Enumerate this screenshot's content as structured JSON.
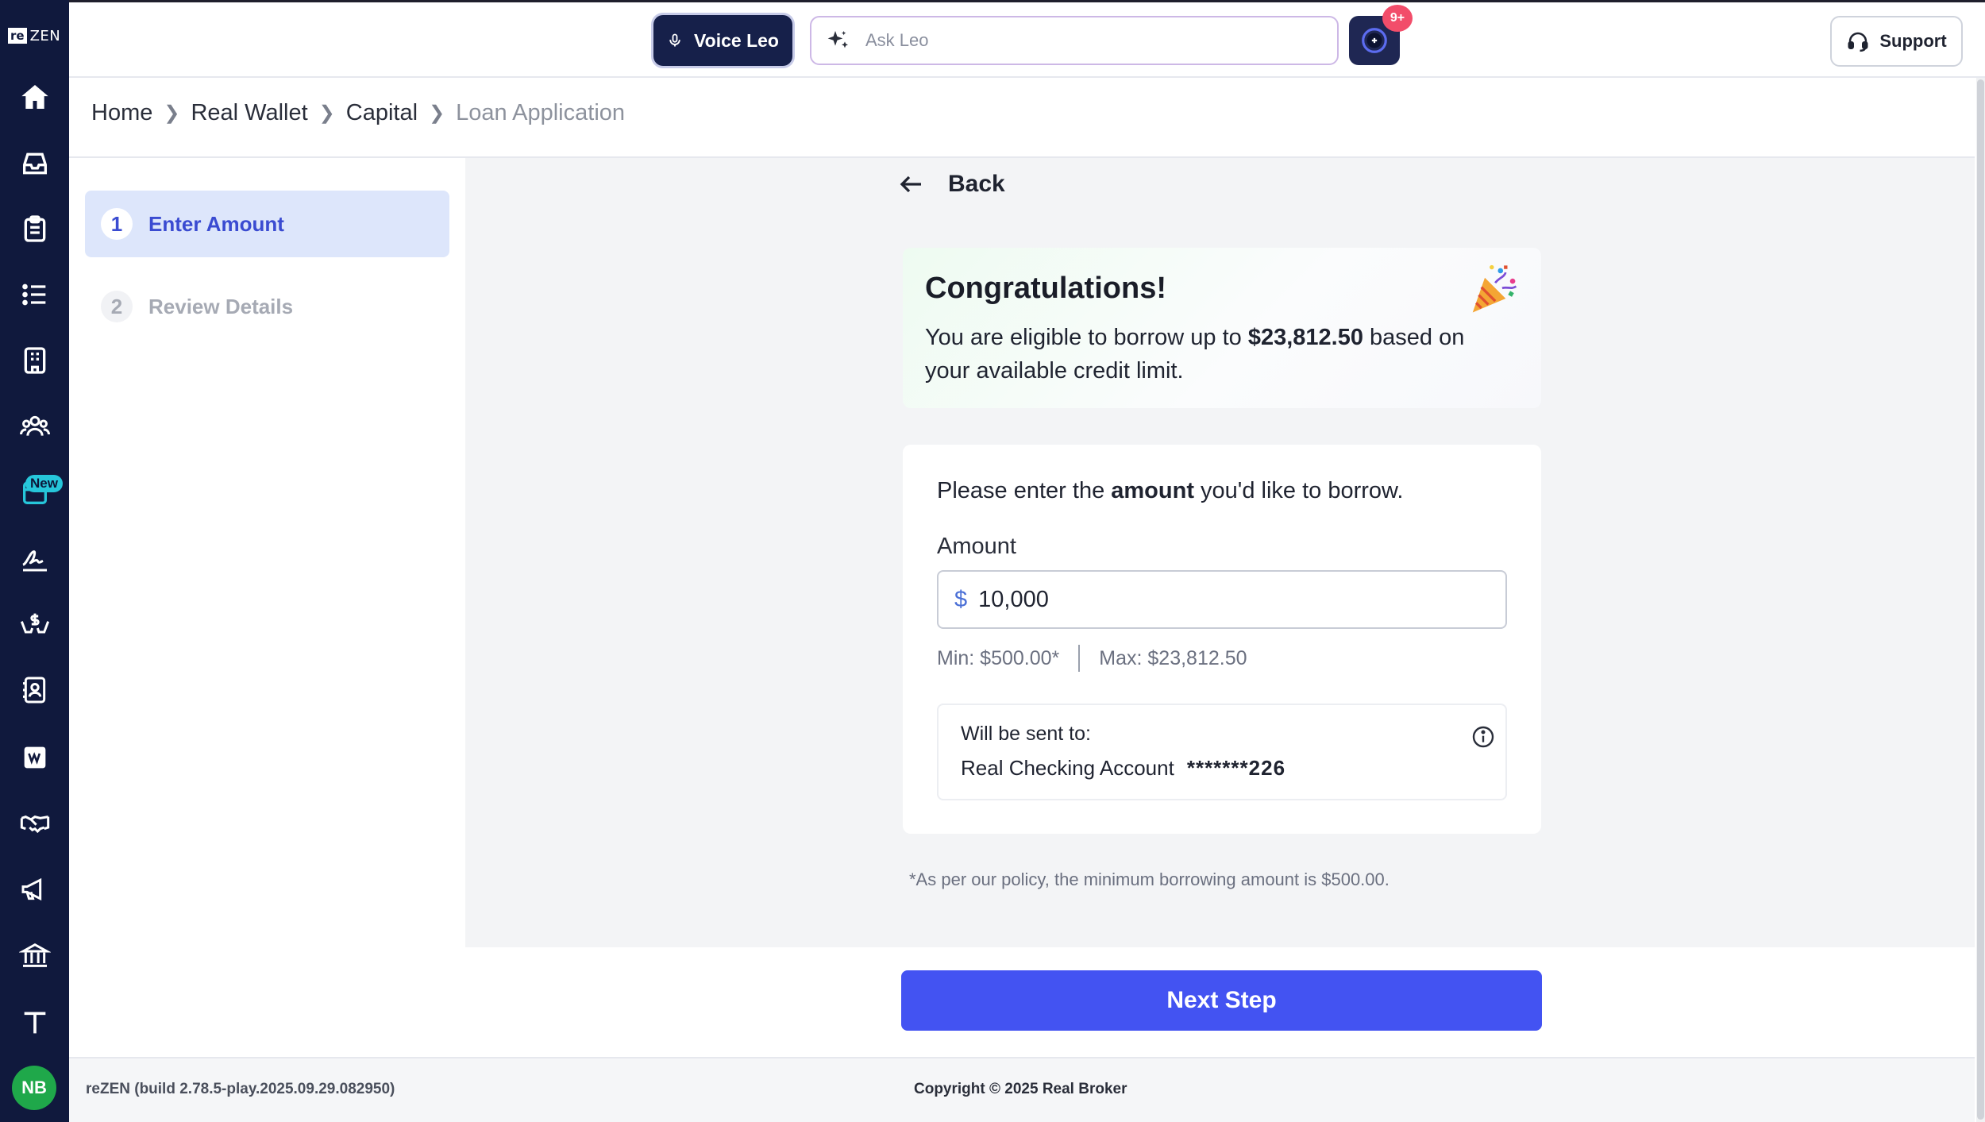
{
  "app": {
    "logo_mark": "re",
    "logo_text": "ZEN"
  },
  "rail": {
    "icons": [
      "home-icon",
      "inbox-icon",
      "clipboard-icon",
      "list-icon",
      "building-icon",
      "people-icon",
      "calendar-new-icon",
      "signature-icon",
      "money-hands-icon",
      "contact-book-icon",
      "wallet-logo-icon",
      "handshake-icon",
      "megaphone-icon",
      "bank-icon",
      "text-icon"
    ],
    "new_badge": "New",
    "avatar_initials": "NB"
  },
  "topbar": {
    "voice_label": "Voice Leo",
    "ask_placeholder": "Ask Leo",
    "notifications": "9+",
    "support_label": "Support"
  },
  "breadcrumb": {
    "items": [
      "Home",
      "Real Wallet",
      "Capital"
    ],
    "current": "Loan Application"
  },
  "stepper": {
    "steps": [
      {
        "number": "1",
        "label": "Enter Amount",
        "active": true
      },
      {
        "number": "2",
        "label": "Review Details",
        "active": false
      }
    ]
  },
  "main": {
    "back_label": "Back",
    "congrats": {
      "title": "Congratulations!",
      "text_before": "You are eligible to borrow up to ",
      "amount": "$23,812.50",
      "text_after": " based on your available credit limit."
    },
    "form": {
      "prompt_before": "Please enter the ",
      "prompt_bold": "amount",
      "prompt_after": " you'd like to borrow.",
      "amount_label": "Amount",
      "currency_symbol": "$",
      "amount_value": "10,000",
      "min_text": "Min: $500.00*",
      "max_text": "Max: $23,812.50",
      "sent_to_label": "Will be sent to:",
      "account_name": "Real Checking Account",
      "account_mask": "*******226"
    },
    "policy_note": "*As per our policy, the minimum borrowing amount is $500.00.",
    "next_label": "Next Step"
  },
  "footer": {
    "build": "reZEN (build 2.78.5-play.2025.09.29.082950)",
    "copyright": "Copyright © 2025 Real Broker"
  },
  "colors": {
    "rail_bg": "#10193d",
    "primary": "#4353f2",
    "active_step_bg": "#dde6fb",
    "active_step_text": "#3a4bd1",
    "avatar": "#1fa84a",
    "notif_badge": "#f24d6a",
    "new_badge": "#26c6da"
  }
}
